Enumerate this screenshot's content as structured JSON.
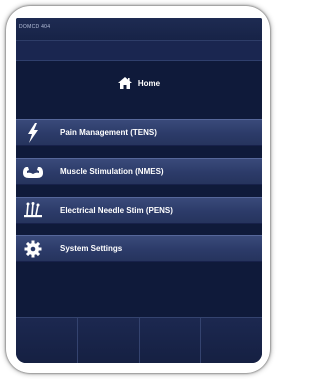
{
  "status_bar": {
    "device_label": "DOMCD 404"
  },
  "home": {
    "label": "Home",
    "icon": "home-icon"
  },
  "menu": {
    "items": [
      {
        "label": "Pain Management (TENS)",
        "icon": "lightning-bolt-icon"
      },
      {
        "label": "Muscle Stimulation (NMES)",
        "icon": "flexed-arm-icon"
      },
      {
        "label": "Electrical Needle Stim (PENS)",
        "icon": "needles-icon"
      },
      {
        "label": "System Settings",
        "icon": "gear-icon"
      }
    ]
  },
  "nav_bar": {
    "button_count": 4
  },
  "colors": {
    "screen_background": "#0f1a3a",
    "menu_item_background": "#2c3b69",
    "text": "#ffffff"
  }
}
